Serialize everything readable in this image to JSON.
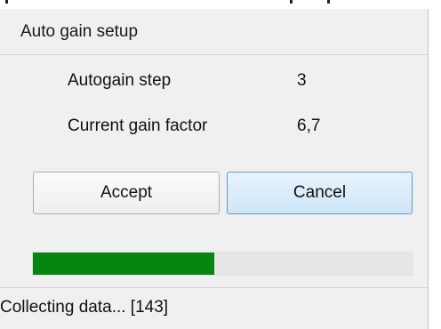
{
  "window": {
    "title": "Auto gain setup"
  },
  "fields": [
    {
      "label": "Autogain step",
      "value": "3"
    },
    {
      "label": "Current gain factor",
      "value": "6,7"
    }
  ],
  "buttons": {
    "accept_label": "Accept",
    "cancel_label": "Cancel"
  },
  "progress": {
    "fraction": 0.48,
    "fill_color": "#06850f",
    "track_color": "#e6e6e6"
  },
  "status": {
    "text": "Collecting data... [143]"
  },
  "colors": {
    "dialog_bg": "#f0f0f0",
    "cancel_accent": "#5d9bd3"
  }
}
